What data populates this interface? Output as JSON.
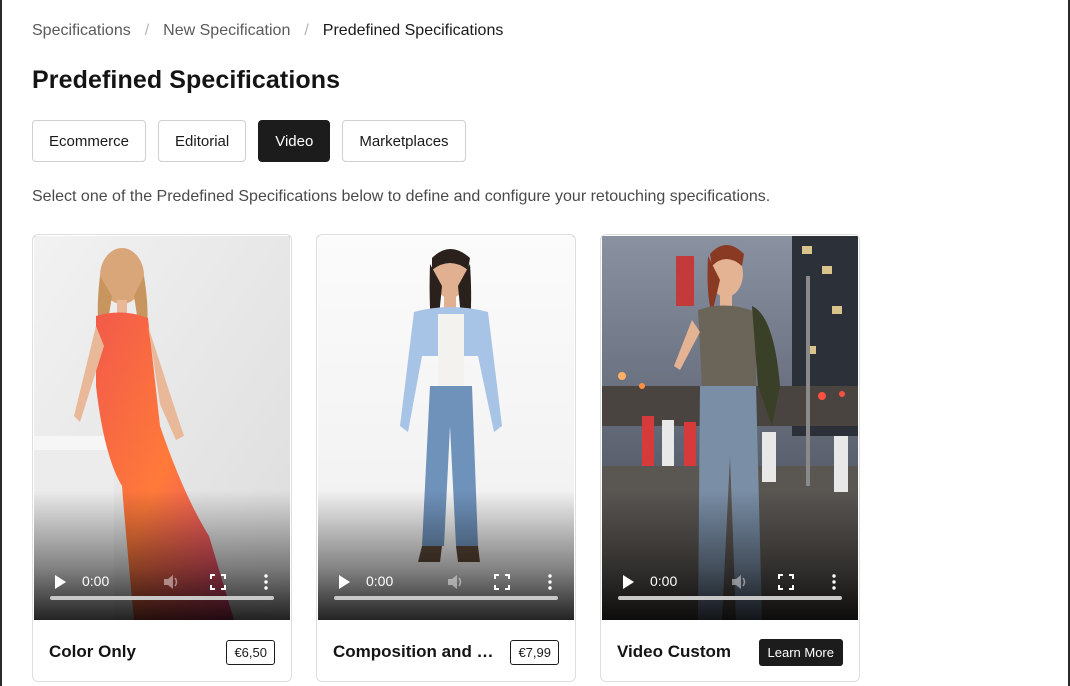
{
  "breadcrumb": {
    "items": [
      "Specifications",
      "New Specification",
      "Predefined Specifications"
    ],
    "separator": "/"
  },
  "page_title": "Predefined Specifications",
  "tabs": [
    {
      "label": "Ecommerce",
      "active": false
    },
    {
      "label": "Editorial",
      "active": false
    },
    {
      "label": "Video",
      "active": true
    },
    {
      "label": "Marketplaces",
      "active": false
    }
  ],
  "description": "Select one of the Predefined Specifications below to define and configure your retouching specifications.",
  "cards": [
    {
      "title": "Color Only",
      "price": "€6,50",
      "video": {
        "time": "0:00",
        "progress": 0
      },
      "icons": [
        "play-icon",
        "volume-icon",
        "fullscreen-icon",
        "more-vertical-icon"
      ]
    },
    {
      "title": "Composition and Co...",
      "price": "€7,99",
      "video": {
        "time": "0:00",
        "progress": 0
      },
      "icons": [
        "play-icon",
        "volume-icon",
        "fullscreen-icon",
        "more-vertical-icon"
      ]
    },
    {
      "title": "Video Custom",
      "action_label": "Learn More",
      "video": {
        "time": "0:00",
        "progress": 0
      },
      "icons": [
        "play-icon",
        "volume-icon",
        "fullscreen-icon",
        "more-vertical-icon"
      ]
    }
  ],
  "colors": {
    "accent_dark": "#1c1c1c",
    "border": "#cfcfcf",
    "text_primary": "#141414",
    "text_secondary": "#4a4a4a"
  }
}
